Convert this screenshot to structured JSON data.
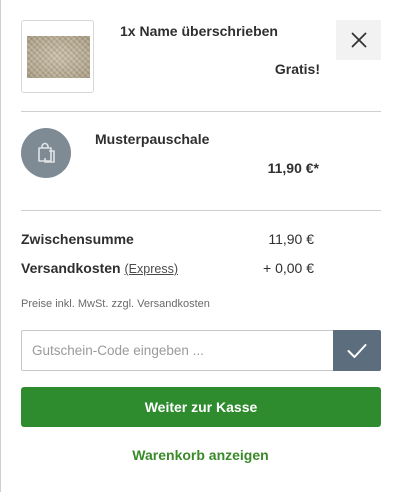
{
  "items": [
    {
      "name": "1x Name überschrieben",
      "price": "Gratis!",
      "image": "burlap-texture-thumbnail"
    },
    {
      "name": "Musterpauschale",
      "price": "11,90 €*",
      "icon": "shopping-bag-icon"
    }
  ],
  "summary": {
    "subtotal_label": "Zwischensumme",
    "subtotal_value": "11,90 €",
    "shipping_label": "Versandkosten",
    "shipping_method": "(Express)",
    "shipping_value": "+ 0,00 €",
    "tax_note": "Preise inkl. MwSt. zzgl. Versandkosten"
  },
  "voucher": {
    "placeholder": "Gutschein-Code eingeben ..."
  },
  "actions": {
    "checkout_label": "Weiter zur Kasse",
    "cart_label": "Warenkorb anzeigen"
  },
  "colors": {
    "primary_green": "#2e8b2e",
    "link_green": "#3a8a2a",
    "voucher_button": "#5c6e7d",
    "bundle_circle": "#7f8b94"
  }
}
